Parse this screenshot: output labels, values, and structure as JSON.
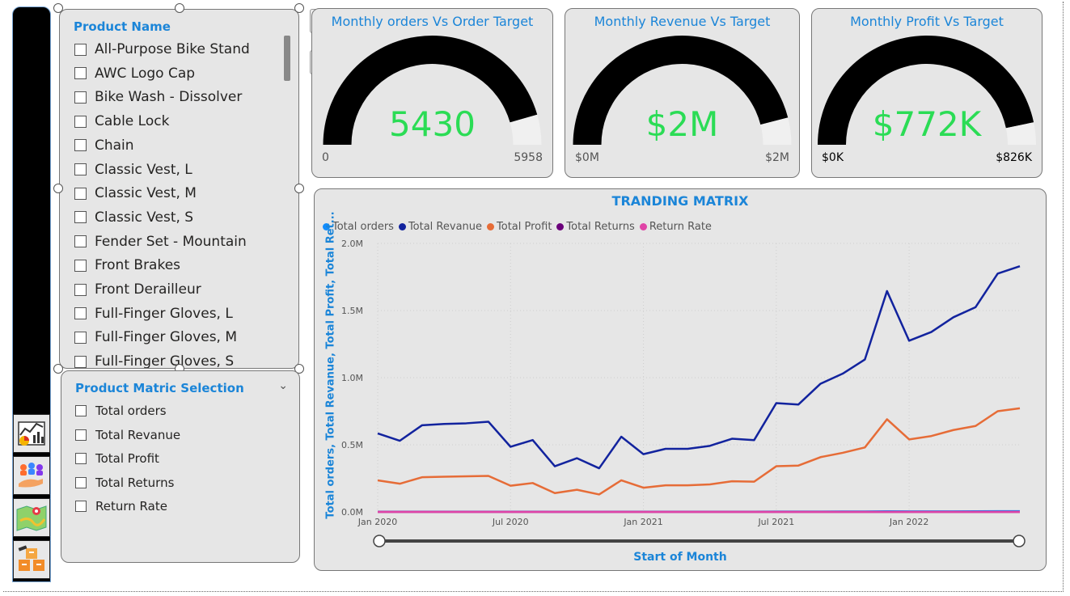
{
  "product_slicer": {
    "title": "Product Name",
    "items": [
      "All-Purpose Bike Stand",
      "AWC Logo Cap",
      "Bike Wash - Dissolver",
      "Cable Lock",
      "Chain",
      "Classic Vest, L",
      "Classic Vest, M",
      "Classic Vest, S",
      "Fender Set - Mountain",
      "Front Brakes",
      "Front Derailleur",
      "Full-Finger Gloves, L",
      "Full-Finger Gloves, M",
      "Full-Finger Gloves, S"
    ]
  },
  "matric_slicer": {
    "title": "Product Matric Selection",
    "items": [
      "Total orders",
      "Total Revanue",
      "Total Profit",
      "Total Returns",
      "Return Rate"
    ]
  },
  "gauges": [
    {
      "title": "Monthly orders Vs Order Target",
      "value": "5430",
      "min": "0",
      "max": "5958",
      "fraction": 0.911
    },
    {
      "title": "Monthly Revenue Vs Target",
      "value": "$2M",
      "min": "$0M",
      "max": "$2M",
      "fraction": 0.92
    },
    {
      "title": "Monthly Profit Vs Target",
      "value": "$772K",
      "min": "$0K",
      "max": "$826K",
      "fraction": 0.934
    }
  ],
  "nav_icons": [
    "trend-chart-icon",
    "customers-icon",
    "map-icon",
    "products-icon"
  ],
  "tool_icons": [
    "visual-analytics-icon",
    "format-paint-icon"
  ],
  "chart_data": {
    "type": "line",
    "title": "TRANDING MATRIX",
    "xlabel": "Start of Month",
    "ylabel": "Total orders, Total Revanue, Total Profit, Total Ret...",
    "x_ticks": [
      "Jan 2020",
      "Jul 2020",
      "Jan 2021",
      "Jul 2021",
      "Jan 2022"
    ],
    "y_ticks": [
      "0.0M",
      "0.5M",
      "1.0M",
      "1.5M",
      "2.0M"
    ],
    "ylim": [
      0,
      2000000
    ],
    "x": [
      "2020-01",
      "2020-02",
      "2020-03",
      "2020-04",
      "2020-05",
      "2020-06",
      "2020-07",
      "2020-08",
      "2020-09",
      "2020-10",
      "2020-11",
      "2020-12",
      "2021-01",
      "2021-02",
      "2021-03",
      "2021-04",
      "2021-05",
      "2021-06",
      "2021-07",
      "2021-08",
      "2021-09",
      "2021-10",
      "2021-11",
      "2021-12",
      "2022-01",
      "2022-02",
      "2022-03",
      "2022-04",
      "2022-05",
      "2022-06"
    ],
    "series": [
      {
        "name": "Total orders",
        "color": "#118dff",
        "values": [
          1500,
          1400,
          1700,
          1700,
          1750,
          1800,
          1300,
          1450,
          950,
          1100,
          900,
          1550,
          1200,
          1300,
          1300,
          1350,
          1500,
          1450,
          2200,
          2150,
          2600,
          2800,
          3100,
          4500,
          3500,
          3700,
          4000,
          4200,
          4900,
          5430
        ]
      },
      {
        "name": "Total Revanue",
        "color": "#12239e",
        "values": [
          585000,
          530000,
          645000,
          655000,
          660000,
          672000,
          485000,
          535000,
          340000,
          400000,
          325000,
          560000,
          430000,
          470000,
          470000,
          492000,
          545000,
          535000,
          810000,
          800000,
          955000,
          1030000,
          1135000,
          1645000,
          1275000,
          1340000,
          1450000,
          1525000,
          1775000,
          1830000
        ]
      },
      {
        "name": "Total Profit",
        "color": "#e66c37",
        "values": [
          235000,
          210000,
          258000,
          262000,
          265000,
          268000,
          195000,
          215000,
          140000,
          165000,
          130000,
          235000,
          180000,
          198000,
          198000,
          205000,
          228000,
          225000,
          340000,
          345000,
          408000,
          440000,
          480000,
          690000,
          540000,
          565000,
          610000,
          640000,
          750000,
          772000
        ]
      },
      {
        "name": "Total Returns",
        "color": "#6b007b",
        "values": [
          40,
          38,
          45,
          46,
          46,
          47,
          34,
          38,
          24,
          28,
          23,
          39,
          30,
          33,
          33,
          34,
          38,
          37,
          57,
          56,
          67,
          72,
          80,
          115,
          89,
          94,
          101,
          107,
          124,
          129
        ]
      },
      {
        "name": "Return Rate",
        "color": "#e044a7",
        "values": [
          0.03,
          0.03,
          0.03,
          0.03,
          0.03,
          0.03,
          0.03,
          0.03,
          0.03,
          0.03,
          0.03,
          0.03,
          0.03,
          0.03,
          0.03,
          0.03,
          0.03,
          0.03,
          0.03,
          0.03,
          0.03,
          0.03,
          0.03,
          0.03,
          0.03,
          0.03,
          0.03,
          0.03,
          0.03,
          0.03
        ]
      }
    ],
    "legend_position": "top-left",
    "grid": true
  }
}
